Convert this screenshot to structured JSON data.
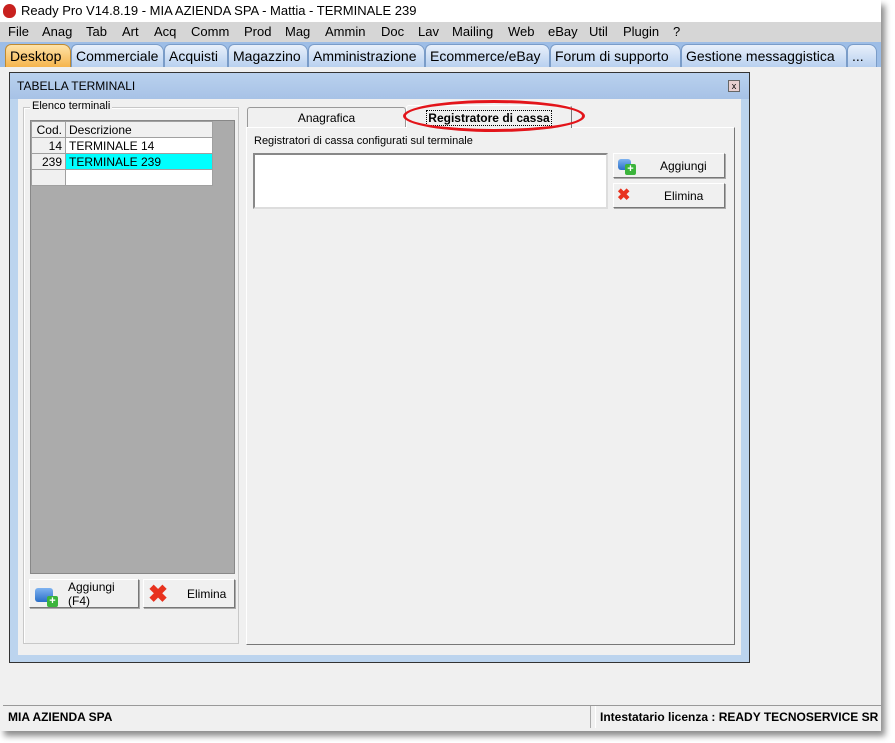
{
  "app": {
    "title": "Ready Pro V14.8.19 - MIA AZIENDA SPA - Mattia - TERMINALE 239"
  },
  "menu": [
    "File",
    "Anag",
    "Tab",
    "Art",
    "Acq",
    "Comm",
    "Prod",
    "Mag",
    "Ammin",
    "Doc",
    "Lav",
    "Mailing",
    "Web",
    "eBay",
    "Util",
    "Plugin",
    "?"
  ],
  "tabs": [
    "Desktop",
    "Commerciale",
    "Acquisti",
    "Magazzino",
    "Amministrazione",
    "Ecommerce/eBay",
    "Forum di supporto",
    "Gestione messaggistica",
    "..."
  ],
  "active_tab": "Desktop",
  "window": {
    "title": "TABELLA TERMINALI",
    "close": "x"
  },
  "terminals": {
    "group_label": "Elenco terminali",
    "headers": [
      "Cod.",
      "Descrizione"
    ],
    "rows": [
      {
        "cod": "14",
        "desc": "TERMINALE 14"
      },
      {
        "cod": "239",
        "desc": "TERMINALE 239",
        "selected": true
      }
    ],
    "selected_color": "#00ffff",
    "add_label": "Aggiungi (F4)",
    "delete_label": "Elimina"
  },
  "detail": {
    "tabs": [
      "Anagrafica",
      "Registratore di cassa"
    ],
    "active_tab": "Registratore di cassa",
    "list_label": "Registratori di cassa configurati sul terminale",
    "add_label": "Aggiungi",
    "delete_label": "Elimina",
    "highlight_color": "#e3141a"
  },
  "status": {
    "company": "MIA AZIENDA SPA",
    "license": "Intestatario licenza : READY TECNOSERVICE SR"
  }
}
